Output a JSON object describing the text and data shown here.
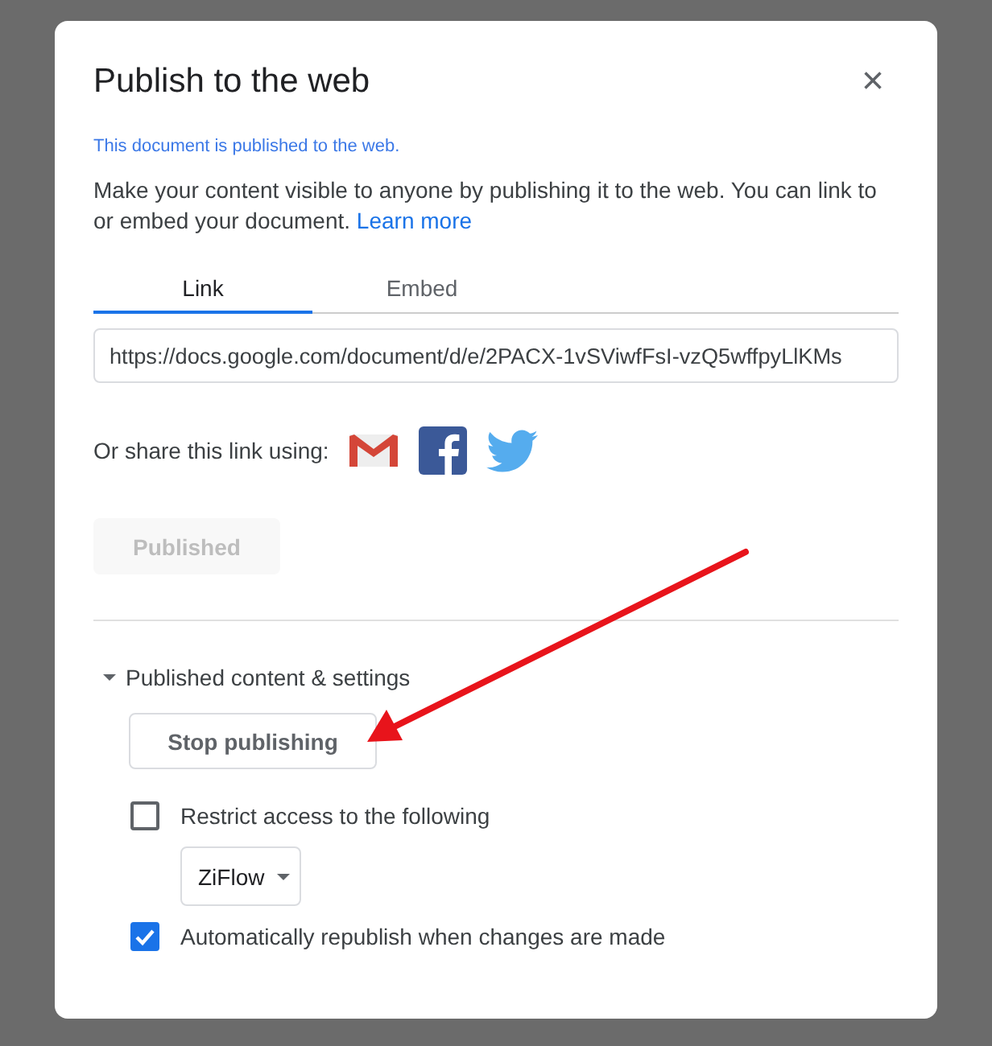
{
  "dialog": {
    "title": "Publish to the web",
    "close": "×",
    "status": "This document is published to the web.",
    "description": "Make your content visible to anyone by publishing it to the web. You can link to or embed your document.",
    "learn_more": "Learn more"
  },
  "tabs": [
    {
      "label": "Link",
      "selected": true
    },
    {
      "label": "Embed",
      "selected": false
    }
  ],
  "url_field": {
    "value": "https://docs.google.com/document/d/e/2PACX-1vSViwfFsI-vzQ5wffpyLlKMs"
  },
  "share": {
    "label": "Or share this link using:",
    "services": [
      {
        "kind": "gmail"
      },
      {
        "kind": "facebook"
      },
      {
        "kind": "twitter"
      }
    ]
  },
  "publish_button": {
    "label": "Published",
    "disabled": true
  },
  "settings": {
    "label": "Published content & settings",
    "expanded": true,
    "stop_button": "Stop publishing",
    "options": [
      {
        "kind": "checkbox",
        "label": "Restrict access to the following",
        "checked": false
      },
      {
        "kind": "dropdown",
        "value": "ZiFlow"
      },
      {
        "kind": "checkbox",
        "label": "Automatically republish when changes are made",
        "checked": true
      }
    ]
  }
}
